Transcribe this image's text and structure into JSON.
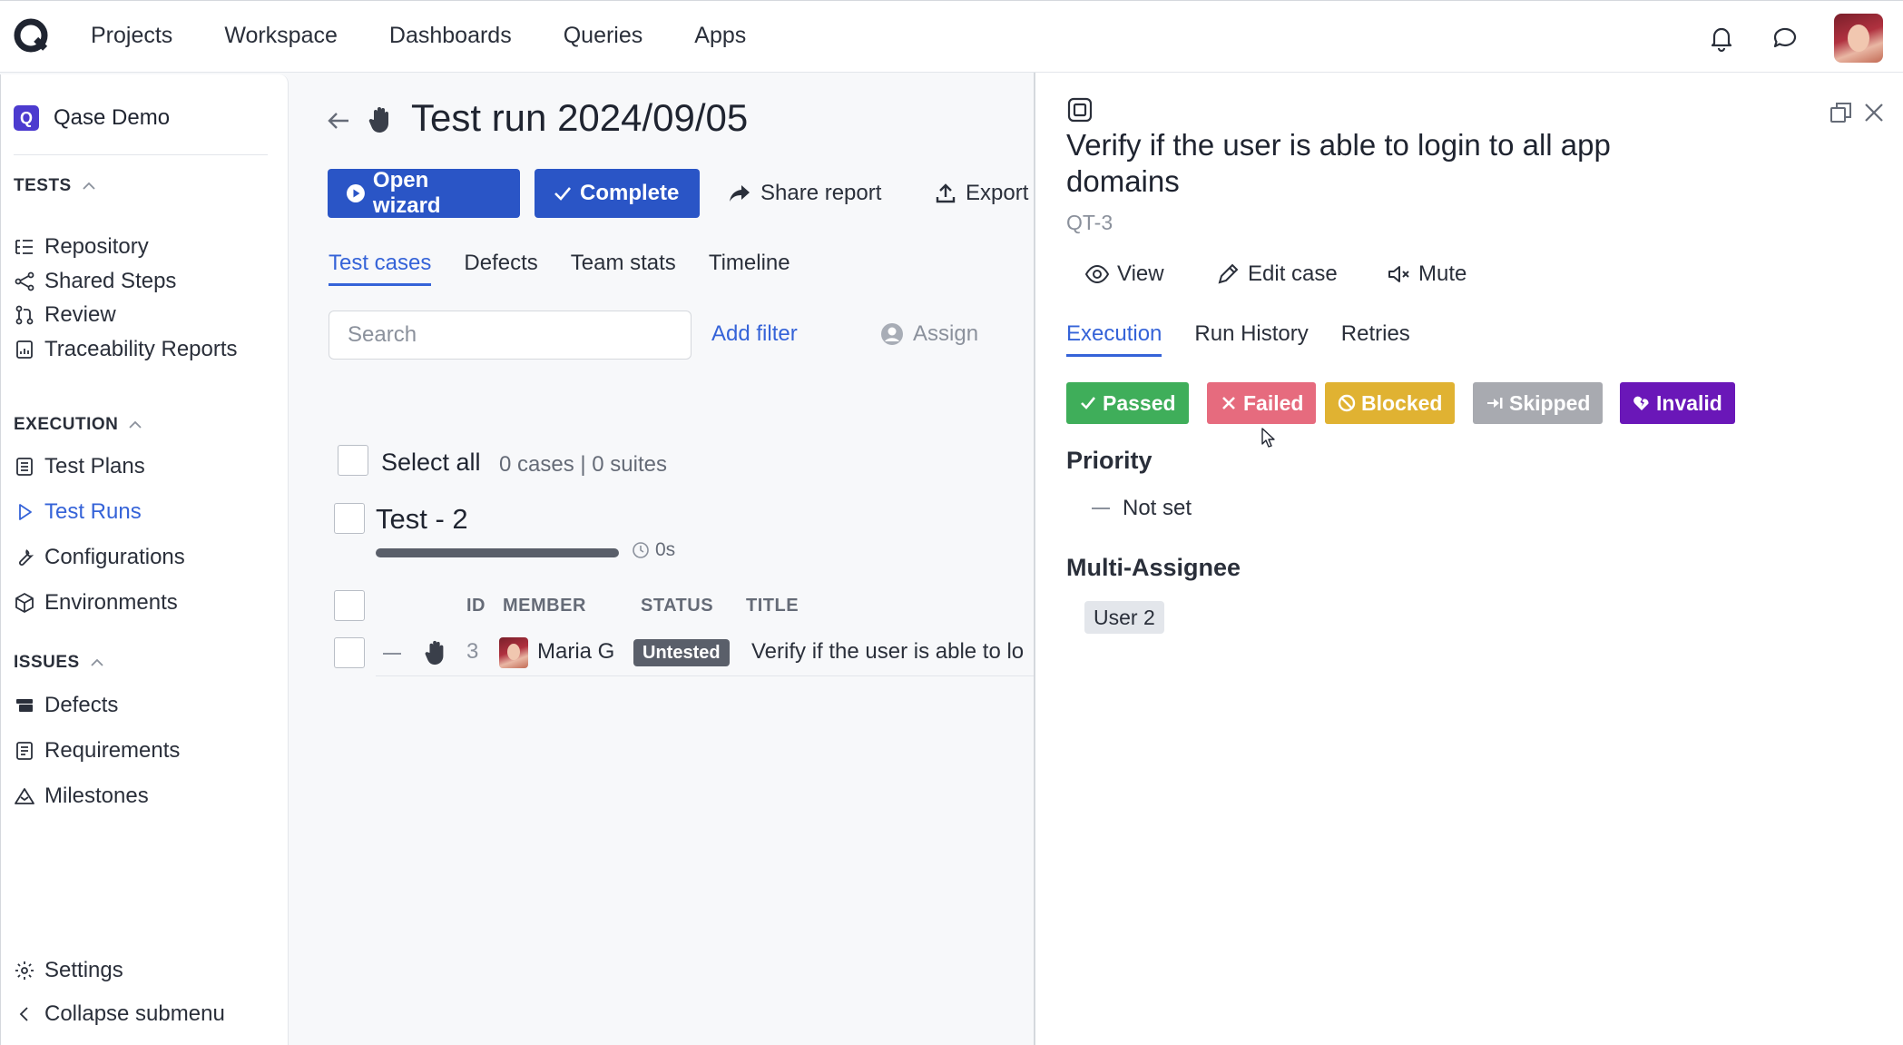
{
  "topnav": {
    "items": [
      "Projects",
      "Workspace",
      "Dashboards",
      "Queries",
      "Apps"
    ]
  },
  "sidebar": {
    "project_name": "Qase Demo",
    "project_letter": "Q",
    "sections": {
      "tests": "TESTS",
      "execution": "EXECUTION",
      "issues": "ISSUES"
    },
    "tests_items": [
      "Repository",
      "Shared Steps",
      "Review",
      "Traceability Reports"
    ],
    "execution_items": [
      "Test Plans",
      "Test Runs",
      "Configurations",
      "Environments"
    ],
    "issues_items": [
      "Defects",
      "Requirements",
      "Milestones"
    ],
    "active_item": "Test Runs",
    "settings": "Settings",
    "collapse": "Collapse submenu"
  },
  "run": {
    "title": "Test run 2024/09/05",
    "buttons": {
      "open_wizard": "Open wizard",
      "complete": "Complete",
      "share_report": "Share report",
      "export": "Export"
    },
    "tabs": [
      "Test cases",
      "Defects",
      "Team stats",
      "Timeline"
    ],
    "active_tab": "Test cases",
    "search_placeholder": "Search",
    "add_filter": "Add filter",
    "assign": "Assign",
    "select_all": "Select all",
    "counts": "0 cases | 0 suites",
    "suite": {
      "title": "Test - 2",
      "progress": 1.0,
      "duration": "0s"
    },
    "columns": [
      "ID",
      "MEMBER",
      "STATUS",
      "TITLE"
    ],
    "rows": [
      {
        "id": "3",
        "member": "Maria G",
        "status": "Untested",
        "title": "Verify if the user is able to lo"
      }
    ]
  },
  "drawer": {
    "case_title": "Verify if the user is able to login to all app domains",
    "case_id": "QT-3",
    "actions": {
      "view": "View",
      "edit": "Edit case",
      "mute": "Mute"
    },
    "tabs": [
      "Execution",
      "Run History",
      "Retries"
    ],
    "active_tab": "Execution",
    "statuses": [
      {
        "label": "Passed",
        "color": "#3fae5a"
      },
      {
        "label": "Failed",
        "color": "#e66b7e"
      },
      {
        "label": "Blocked",
        "color": "#e0b232"
      },
      {
        "label": "Skipped",
        "color": "#a8aab0"
      },
      {
        "label": "Invalid",
        "color": "#6a17b8"
      }
    ],
    "priority_label": "Priority",
    "priority_value": "Not set",
    "assignee_label": "Multi-Assignee",
    "assignee_value": "User 2"
  },
  "colors": {
    "accent": "#3563d8",
    "primary_button": "#2a55c6"
  }
}
